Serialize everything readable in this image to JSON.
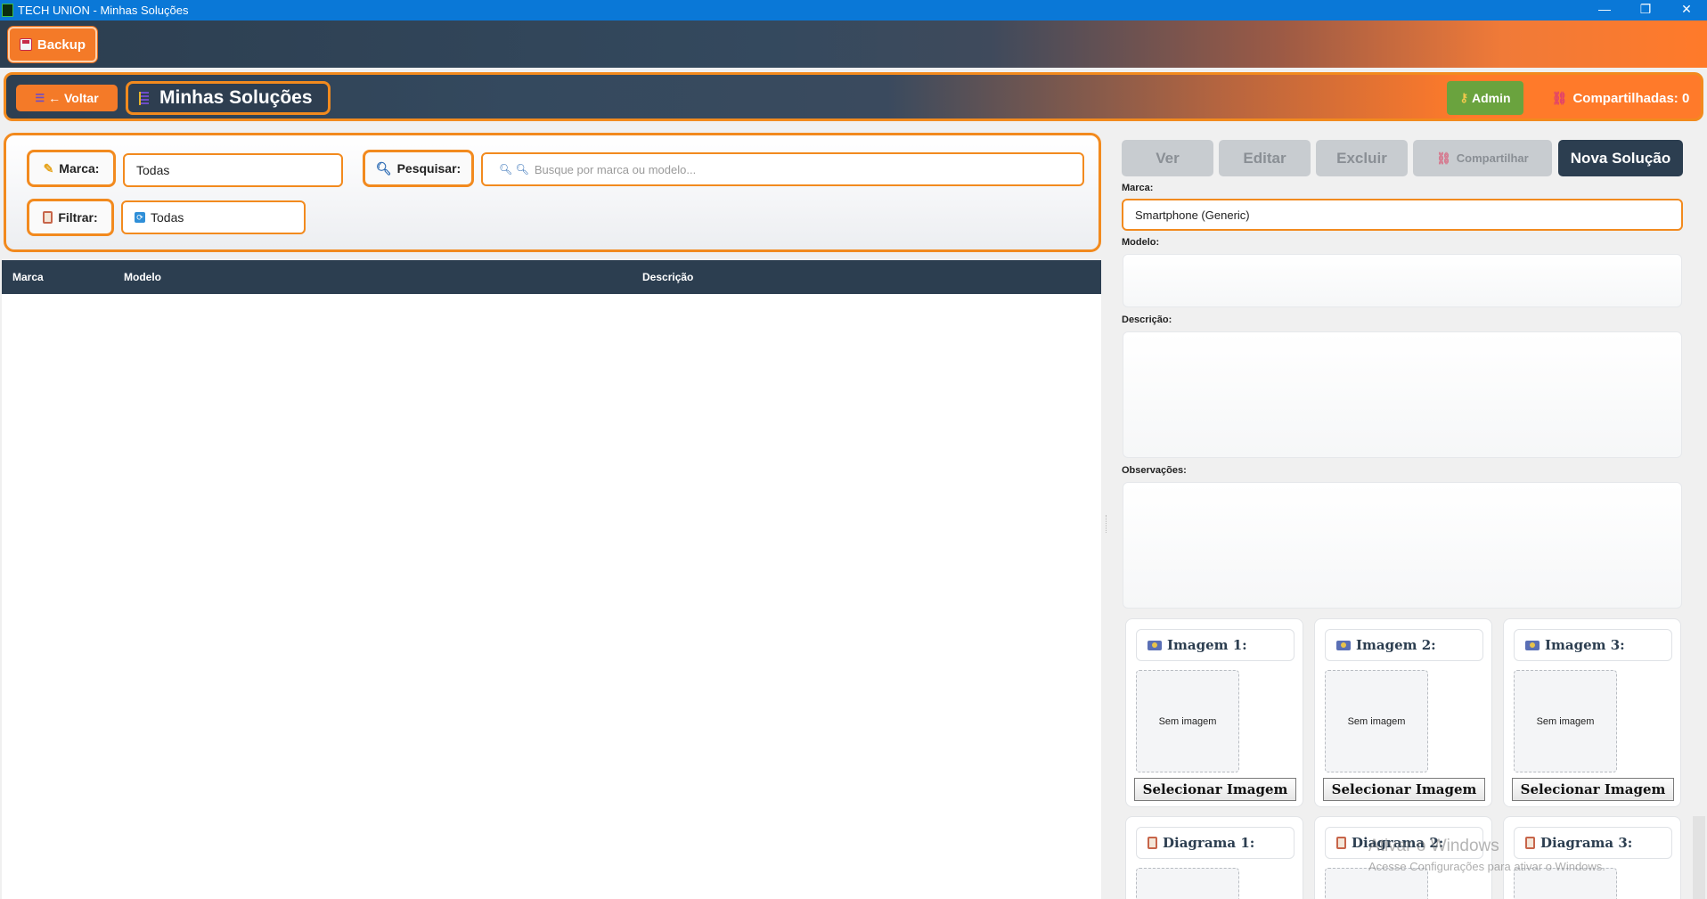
{
  "window": {
    "title": "TECH UNION - Minhas Soluções",
    "minimize_glyph": "—",
    "maximize_glyph": "❐",
    "close_glyph": "✕"
  },
  "toolbar": {
    "backup_label": "Backup"
  },
  "header": {
    "back_label": "← Voltar",
    "page_title": "Minhas Soluções",
    "admin_label": "Admin",
    "shared_label": "Compartilhadas: 0"
  },
  "filters": {
    "marca_label": "Marca:",
    "marca_value": "Todas",
    "search_label": "Pesquisar:",
    "search_placeholder": "Busque por marca ou modelo...",
    "filter_label": "Filtrar:",
    "filter_value": "Todas"
  },
  "table": {
    "columns": [
      "Marca",
      "Modelo",
      "Descrição"
    ],
    "rows": []
  },
  "actions": {
    "view": "Ver",
    "edit": "Editar",
    "delete": "Excluir",
    "share": "Compartilhar",
    "new": "Nova Solução"
  },
  "details": {
    "marca_label": "Marca:",
    "marca_value": "Smartphone (Generic)",
    "modelo_label": "Modelo:",
    "descricao_label": "Descrição:",
    "observacoes_label": "Observações:"
  },
  "images": [
    {
      "title": "Imagem 1:",
      "placeholder": "Sem imagem",
      "button": "Selecionar Imagem"
    },
    {
      "title": "Imagem 2:",
      "placeholder": "Sem imagem",
      "button": "Selecionar Imagem"
    },
    {
      "title": "Imagem 3:",
      "placeholder": "Sem imagem",
      "button": "Selecionar Imagem"
    }
  ],
  "diagrams": [
    {
      "title": "Diagrama 1:"
    },
    {
      "title": "Diagrama 2:"
    },
    {
      "title": "Diagrama 3:"
    }
  ],
  "watermark": {
    "line1": "Ativar o Windows",
    "line2": "Acesse Configurações para ativar o Windows."
  },
  "colors": {
    "accent": "#f28a1e",
    "dark": "#2c3e50",
    "admin": "#6aa33e"
  }
}
